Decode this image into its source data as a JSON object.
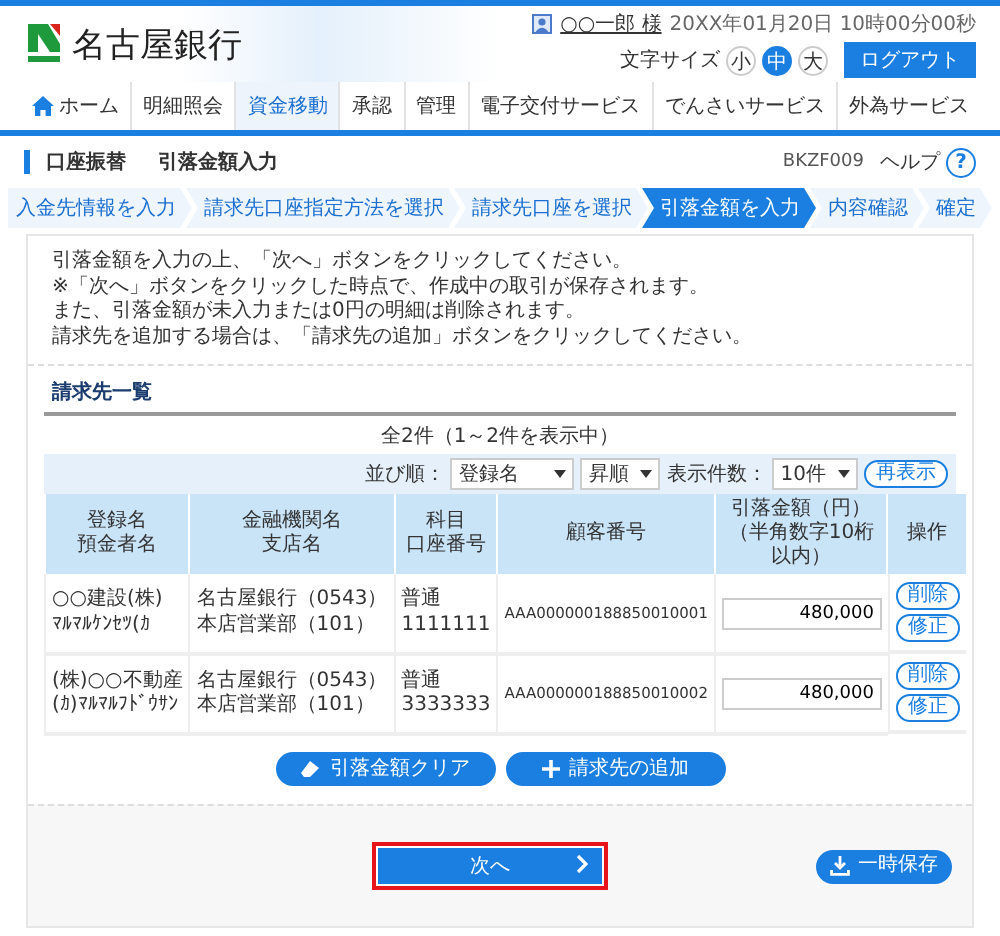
{
  "header": {
    "bank_name": "名古屋銀行",
    "user_name": "○○一郎 様",
    "datetime": "20XX年01月20日 10時00分00秒",
    "text_size": {
      "label": "文字サイズ",
      "options": [
        {
          "label": "小",
          "selected": false
        },
        {
          "label": "中",
          "selected": true
        },
        {
          "label": "大",
          "selected": false
        }
      ]
    },
    "logout": "ログアウト"
  },
  "nav": [
    {
      "label": "ホーム",
      "kind": "home",
      "selected": false
    },
    {
      "label": "明細照会",
      "kind": "text",
      "selected": false
    },
    {
      "label": "資金移動",
      "kind": "text",
      "selected": true
    },
    {
      "label": "承認",
      "kind": "text",
      "selected": false
    },
    {
      "label": "管理",
      "kind": "text",
      "selected": false
    },
    {
      "label": "電子交付サービス",
      "kind": "text",
      "selected": false
    },
    {
      "label": "でんさいサービス",
      "kind": "text",
      "selected": false
    },
    {
      "label": "外為サービス",
      "kind": "text",
      "selected": false
    }
  ],
  "page_title": {
    "section": "口座振替",
    "title": "引落金額入力",
    "code": "BKZF009",
    "help": "ヘルプ",
    "help_icon": "?"
  },
  "steps": [
    {
      "label": "入金先情報を入力",
      "selected": false
    },
    {
      "label": "請求先口座指定方法を選択",
      "selected": false
    },
    {
      "label": "請求先口座を選択",
      "selected": false
    },
    {
      "label": "引落金額を入力",
      "selected": true
    },
    {
      "label": "内容確認",
      "selected": false
    },
    {
      "label": "確定",
      "selected": false
    }
  ],
  "notice": [
    "引落金額を入力の上、「次へ」ボタンをクリックしてください。",
    "※「次へ」ボタンをクリックした時点で、作成中の取引が保存されます。",
    "また、引落金額が未入力または0円の明細は削除されます。",
    "請求先を追加する場合は、「請求先の追加」ボタンをクリックしてください。"
  ],
  "list": {
    "title": "請求先一覧",
    "count": "全2件（1～2件を表示中）",
    "sort_label": "並び順：",
    "sort_field": "登録名",
    "sort_order": "昇順",
    "per_page_label": "表示件数：",
    "per_page": "10件",
    "refresh": "再表示",
    "columns": [
      [
        "登録名",
        "預金者名"
      ],
      [
        "金融機関名",
        "支店名"
      ],
      [
        "科目",
        "口座番号"
      ],
      [
        "顧客番号"
      ],
      [
        "引落金額（円）",
        "（半角数字10桁以内）"
      ],
      [
        "操作"
      ]
    ],
    "rows": [
      {
        "name": "○○建設(株)",
        "kana": "ﾏﾙﾏﾙｹﾝｾﾂ(ｶ",
        "bank": "名古屋銀行（0543）",
        "branch": "本店営業部（101）",
        "type": "普通",
        "account": "1111111",
        "customer": "AAA000000188850010001",
        "amount": "480,000",
        "actions": [
          "削除",
          "修正"
        ]
      },
      {
        "name": "(株)○○不動産",
        "kana": "(ｶ)ﾏﾙﾏﾙﾌﾄﾞｳｻﾝ",
        "bank": "名古屋銀行（0543）",
        "branch": "本店営業部（101）",
        "type": "普通",
        "account": "3333333",
        "customer": "AAA000000188850010002",
        "amount": "480,000",
        "actions": [
          "削除",
          "修正"
        ]
      }
    ]
  },
  "actions": [
    {
      "label": "引落金額クリア",
      "kind": "clear"
    },
    {
      "label": "請求先の追加",
      "kind": "add"
    }
  ],
  "footer": {
    "next": {
      "label": "次へ",
      "highlighted": true
    },
    "save": "一時保存"
  }
}
